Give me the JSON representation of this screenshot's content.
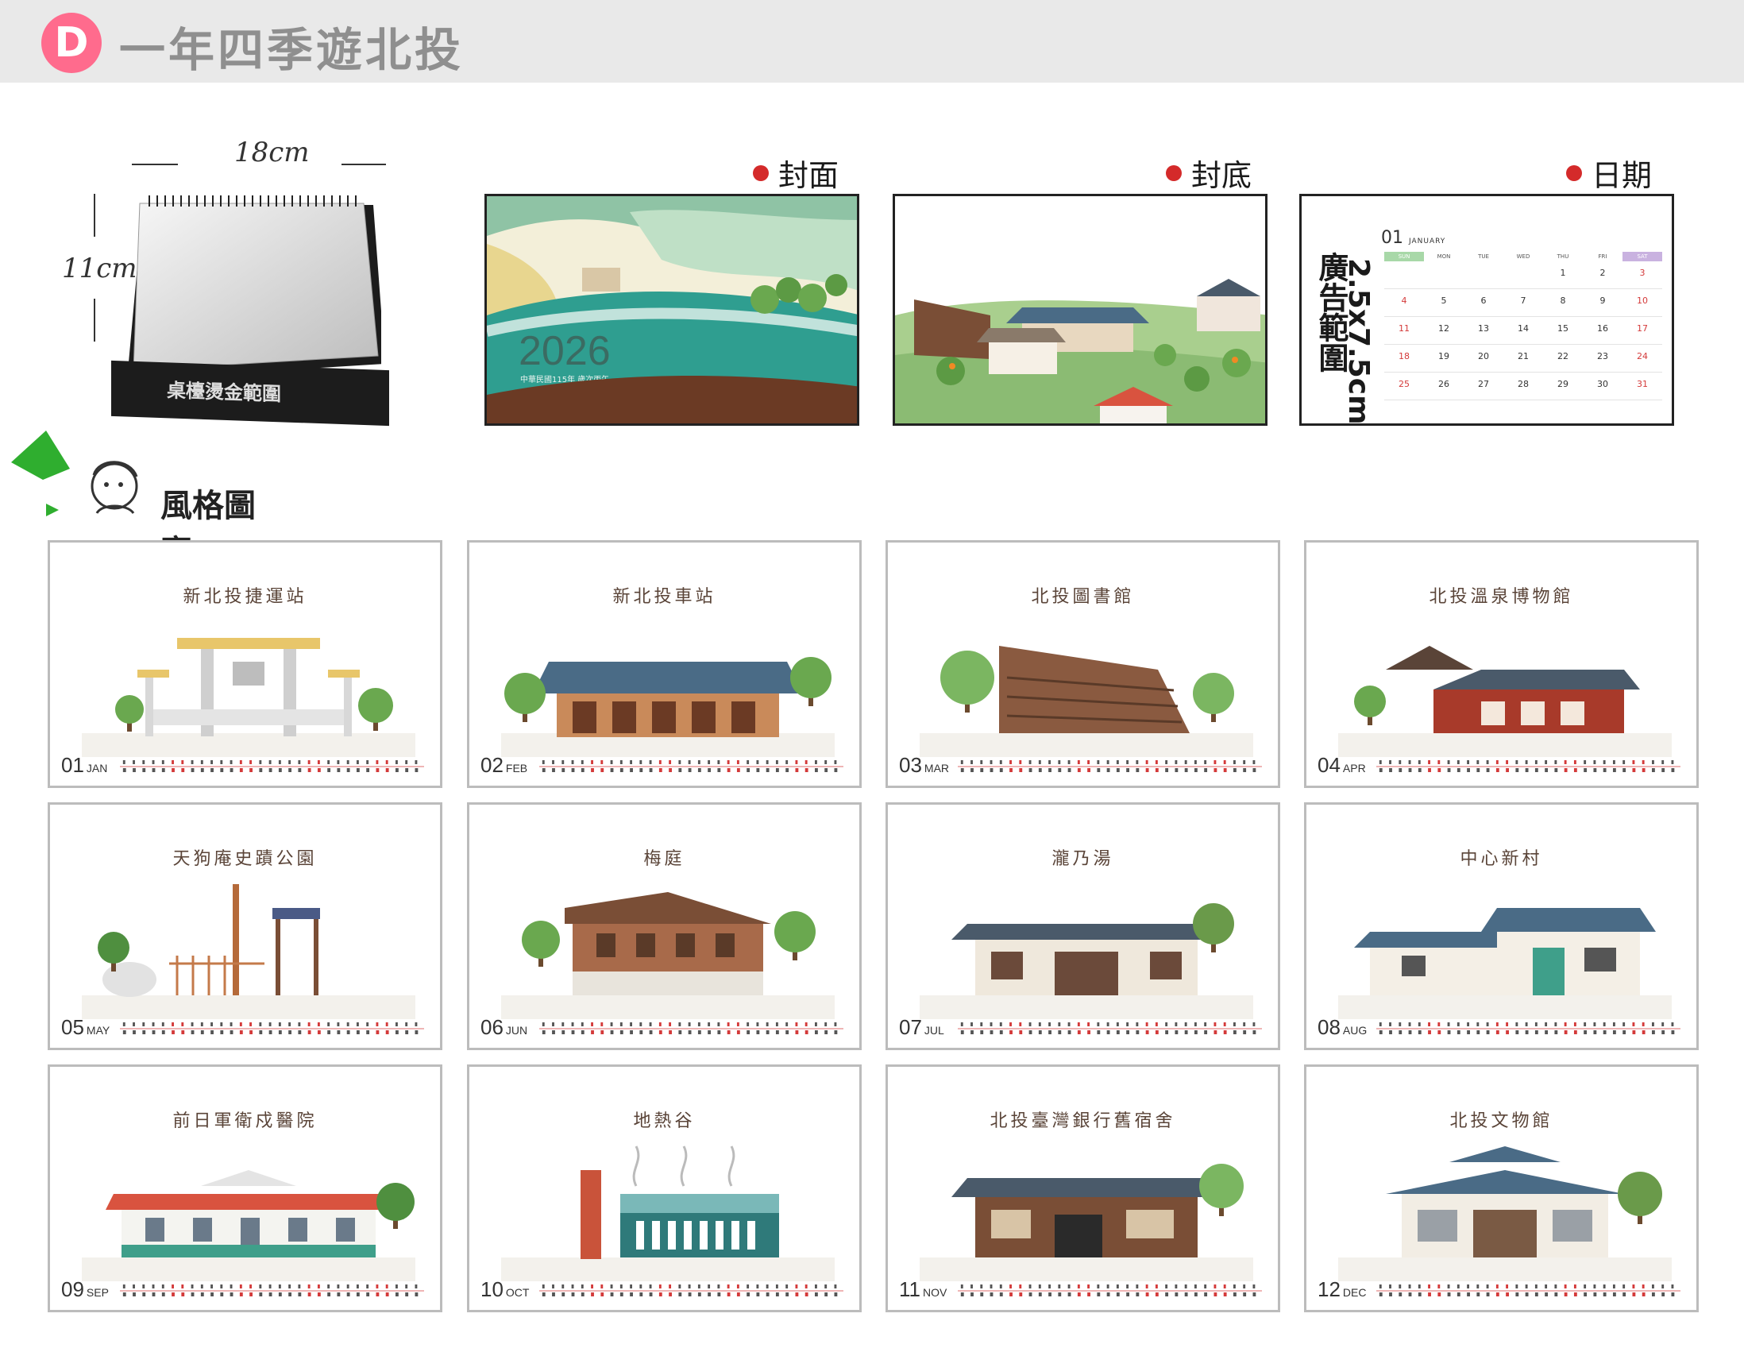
{
  "header": {
    "badge_letter": "D",
    "title": "一年四季遊北投"
  },
  "product": {
    "width_label": "18cm",
    "height_label": "11cm",
    "imprint_label": "桌檯燙金範圍"
  },
  "samples": {
    "cover_label": "封面",
    "back_label": "封底",
    "date_label": "日期",
    "cover": {
      "year": "2026",
      "subtitle": "中華民國115年 歲次丙午"
    },
    "date_page": {
      "month_num": "01",
      "month_name": "JANUARY",
      "ad_size": "2.5x7.5cm",
      "ad_text": "廣告範圍",
      "weekdays": [
        "SUN",
        "MON",
        "TUE",
        "WED",
        "THU",
        "FRI",
        "SAT"
      ],
      "days": [
        "",
        "",
        "",
        "",
        "1",
        "2",
        "3",
        "4",
        "5",
        "6",
        "7",
        "8",
        "9",
        "10",
        "11",
        "12",
        "13",
        "14",
        "15",
        "16",
        "17",
        "18",
        "19",
        "20",
        "21",
        "22",
        "23",
        "24",
        "25",
        "26",
        "27",
        "28",
        "29",
        "30",
        "31"
      ]
    }
  },
  "style_section": {
    "title": "風格圖案"
  },
  "colors": {
    "accent_badge": "#ff6b8d",
    "dot_red": "#d42a2a",
    "header_bg": "#e9e9e9",
    "teal": "#2f9e90",
    "green": "#6aa84f",
    "roof_blue": "#4a6b86",
    "roof_red": "#d9533f"
  },
  "months": [
    {
      "num": "01",
      "abbr": "JAN",
      "title": "新北投捷運站",
      "style": "gate"
    },
    {
      "num": "02",
      "abbr": "FEB",
      "title": "新北投車站",
      "style": "station"
    },
    {
      "num": "03",
      "abbr": "MAR",
      "title": "北投圖書館",
      "style": "library"
    },
    {
      "num": "04",
      "abbr": "APR",
      "title": "北投溫泉博物館",
      "style": "museum"
    },
    {
      "num": "05",
      "abbr": "MAY",
      "title": "天狗庵史蹟公園",
      "style": "park"
    },
    {
      "num": "06",
      "abbr": "JUN",
      "title": "梅庭",
      "style": "meiting"
    },
    {
      "num": "07",
      "abbr": "JUL",
      "title": "瀧乃湯",
      "style": "bath"
    },
    {
      "num": "08",
      "abbr": "AUG",
      "title": "中心新村",
      "style": "village"
    },
    {
      "num": "09",
      "abbr": "SEP",
      "title": "前日軍衛戍醫院",
      "style": "hospital"
    },
    {
      "num": "10",
      "abbr": "OCT",
      "title": "地熱谷",
      "style": "valley"
    },
    {
      "num": "11",
      "abbr": "NOV",
      "title": "北投臺灣銀行舊宿舍",
      "style": "dorm"
    },
    {
      "num": "12",
      "abbr": "DEC",
      "title": "北投文物館",
      "style": "culture"
    }
  ]
}
